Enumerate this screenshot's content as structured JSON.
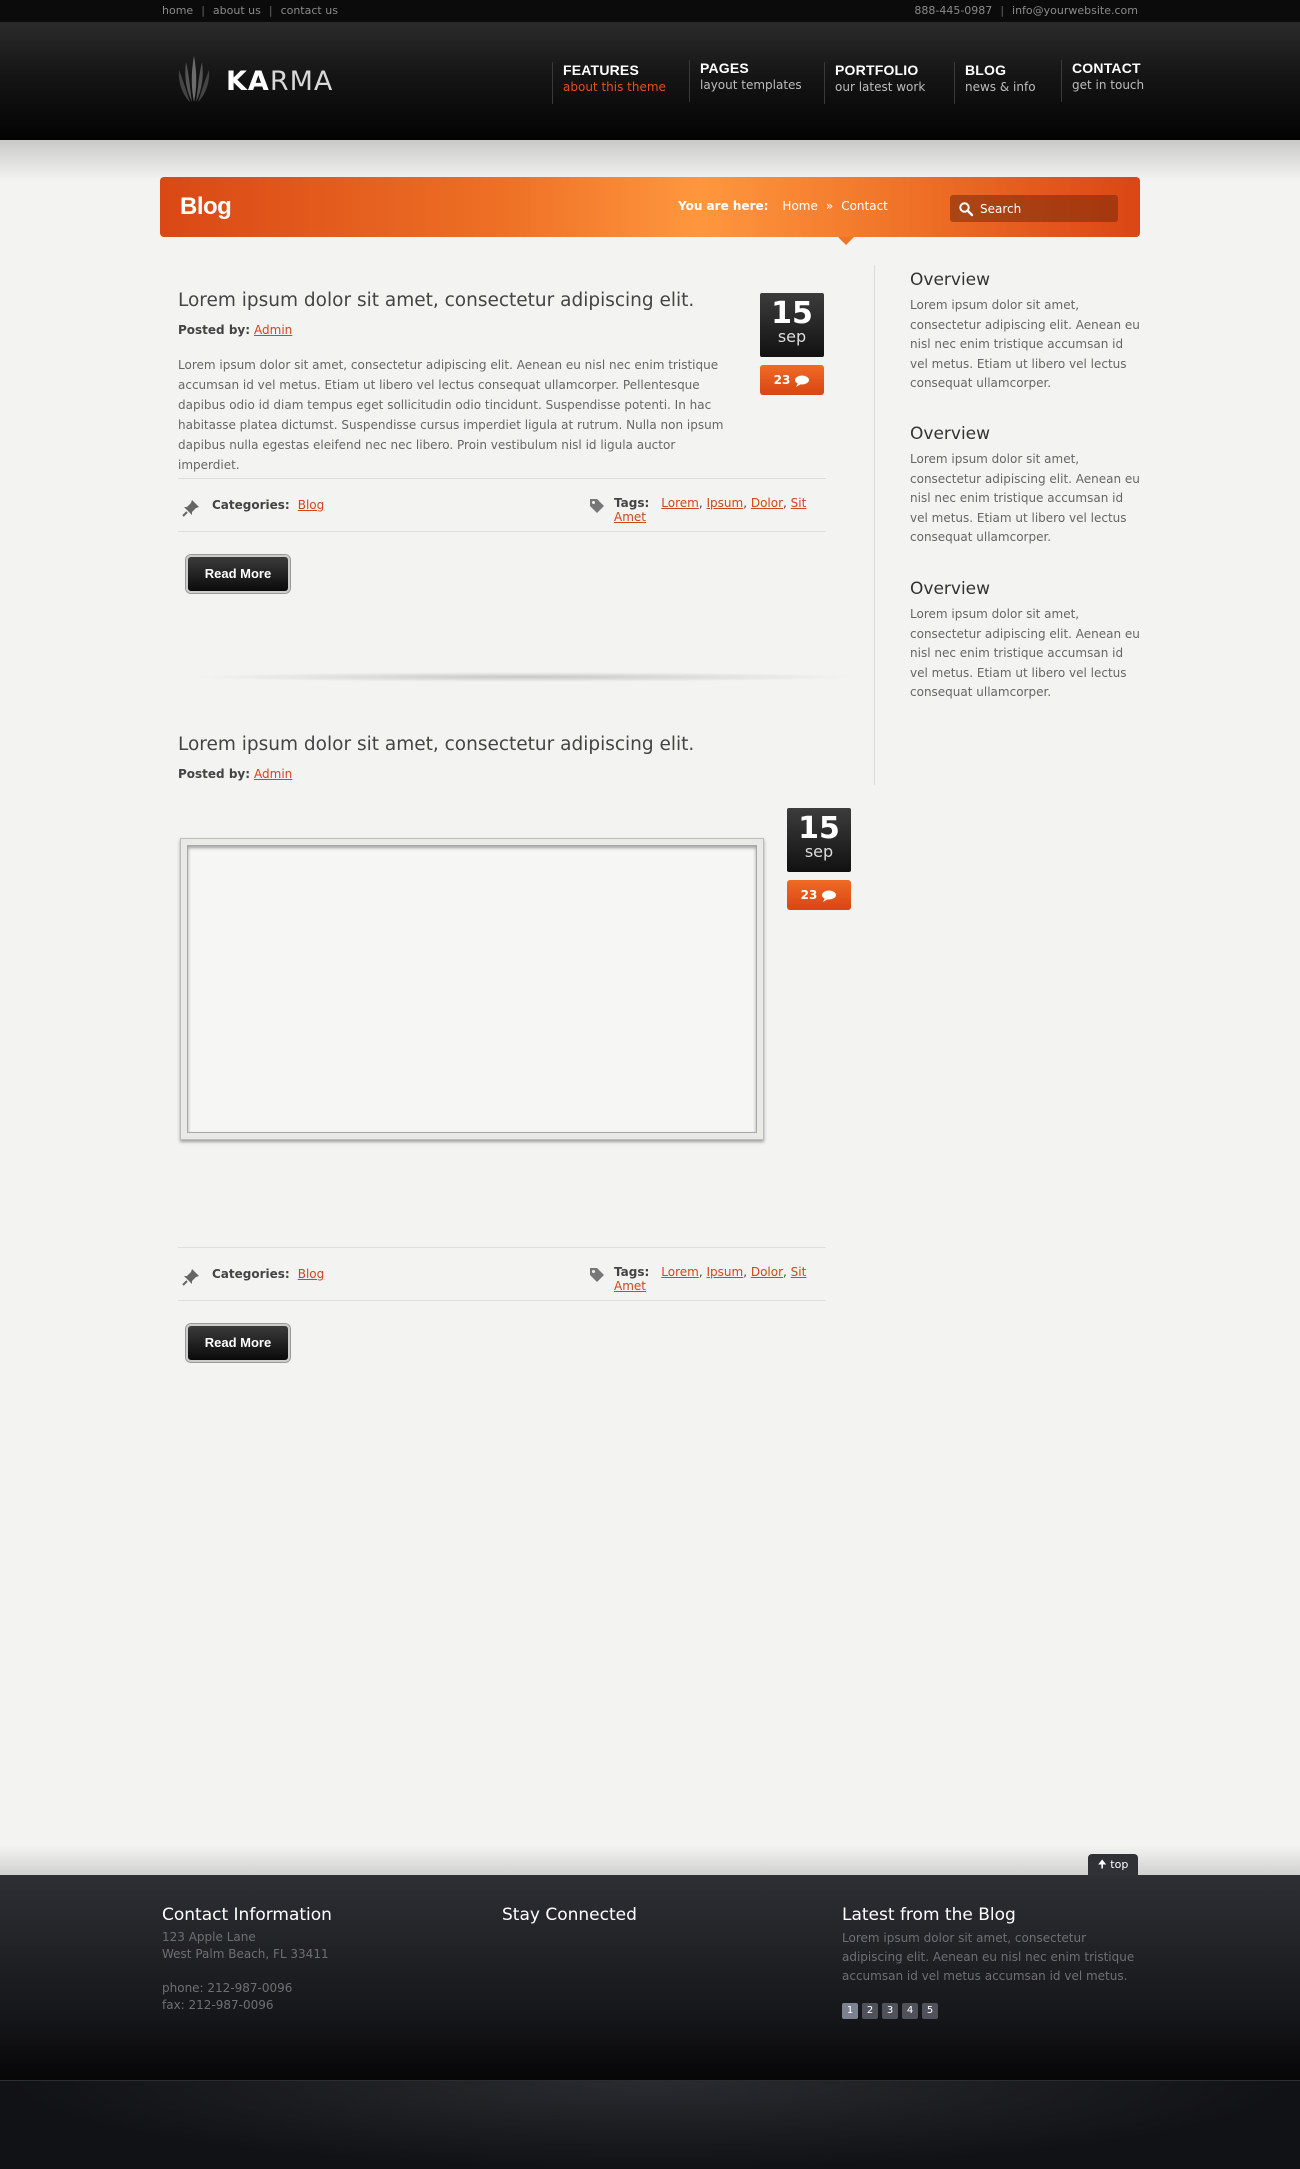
{
  "topbar": {
    "links": [
      "home",
      "about us",
      "contact us"
    ],
    "phone": "888-445-0987",
    "email": "info@yourwebsite.com"
  },
  "logo": {
    "bold": "KA",
    "light": "RMA"
  },
  "nav": [
    {
      "title": "FEATURES",
      "sub": "about this theme"
    },
    {
      "title": "PAGES",
      "sub": "layout templates"
    },
    {
      "title": "PORTFOLIO",
      "sub": "our latest work"
    },
    {
      "title": "BLOG",
      "sub": "news & info"
    },
    {
      "title": "CONTACT",
      "sub": "get in touch"
    }
  ],
  "banner": {
    "title": "Blog",
    "you_are_here": "You are here:",
    "crumbs": [
      "Home",
      "»",
      "Contact"
    ],
    "search_placeholder": "Search"
  },
  "posts": [
    {
      "title": "Lorem ipsum dolor sit amet, consectetur adipiscing elit.",
      "posted_by_label": "Posted by:",
      "author": "Admin",
      "excerpt": "Lorem ipsum dolor sit amet, consectetur adipiscing elit. Aenean eu nisl nec enim tristique accumsan id vel metus. Etiam ut libero vel lectus consequat ullamcorper. Pellentesque dapibus odio id diam tempus eget sollicitudin odio tincidunt. Suspendisse potenti. In hac habitasse platea dictumst. Suspendisse cursus imperdiet ligula at rutrum. Nulla non ipsum dapibus nulla egestas eleifend nec nec libero. Proin vestibulum nisl id ligula auctor imperdiet.",
      "day": "15",
      "month": "sep",
      "comments": "23",
      "categories_label": "Categories:",
      "category": "Blog",
      "tags_label": "Tags:",
      "tags": [
        "Lorem",
        "Ipsum",
        "Dolor",
        "Sit Amet"
      ],
      "read_more": "Read More"
    },
    {
      "title": "Lorem ipsum dolor sit amet, consectetur adipiscing elit.",
      "posted_by_label": "Posted by:",
      "author": "Admin",
      "day": "15",
      "month": "sep",
      "comments": "23",
      "categories_label": "Categories:",
      "category": "Blog",
      "tags_label": "Tags:",
      "tags": [
        "Lorem",
        "Ipsum",
        "Dolor",
        "Sit Amet"
      ],
      "read_more": "Read More"
    }
  ],
  "sidebar": [
    {
      "title": "Overview",
      "text": "Lorem ipsum dolor sit amet, consectetur adipiscing elit. Aenean eu nisl nec enim tristique accumsan id vel metus. Etiam ut libero vel lectus consequat ullamcorper."
    },
    {
      "title": "Overview",
      "text": "Lorem ipsum dolor sit amet, consectetur adipiscing elit. Aenean eu nisl nec enim tristique accumsan id vel metus. Etiam ut libero vel lectus consequat ullamcorper."
    },
    {
      "title": "Overview",
      "text": "Lorem ipsum dolor sit amet, consectetur adipiscing elit. Aenean eu nisl nec enim tristique accumsan id vel metus. Etiam ut libero vel lectus consequat ullamcorper."
    }
  ],
  "footer": {
    "top_label": "top",
    "contact": {
      "title": "Contact Information",
      "street": "123 Apple Lane",
      "city": "West Palm Beach, FL 33411",
      "phone": "phone: 212-987-0096",
      "fax": "fax: 212-987-0096"
    },
    "social": {
      "title": "Stay Connected"
    },
    "blog": {
      "title": "Latest from the Blog",
      "text": "Lorem ipsum dolor sit amet, consectetur adipiscing elit. Aenean eu nisl nec enim tristique accumsan id vel metus accumsan id vel metus.",
      "pages": [
        "1",
        "2",
        "3",
        "4",
        "5"
      ]
    }
  },
  "colors": {
    "accent": "#e2501c",
    "header_bg": "#0b0b0b",
    "page_bg": "#f3f3f1",
    "footer_bg": "#1c1d21"
  }
}
